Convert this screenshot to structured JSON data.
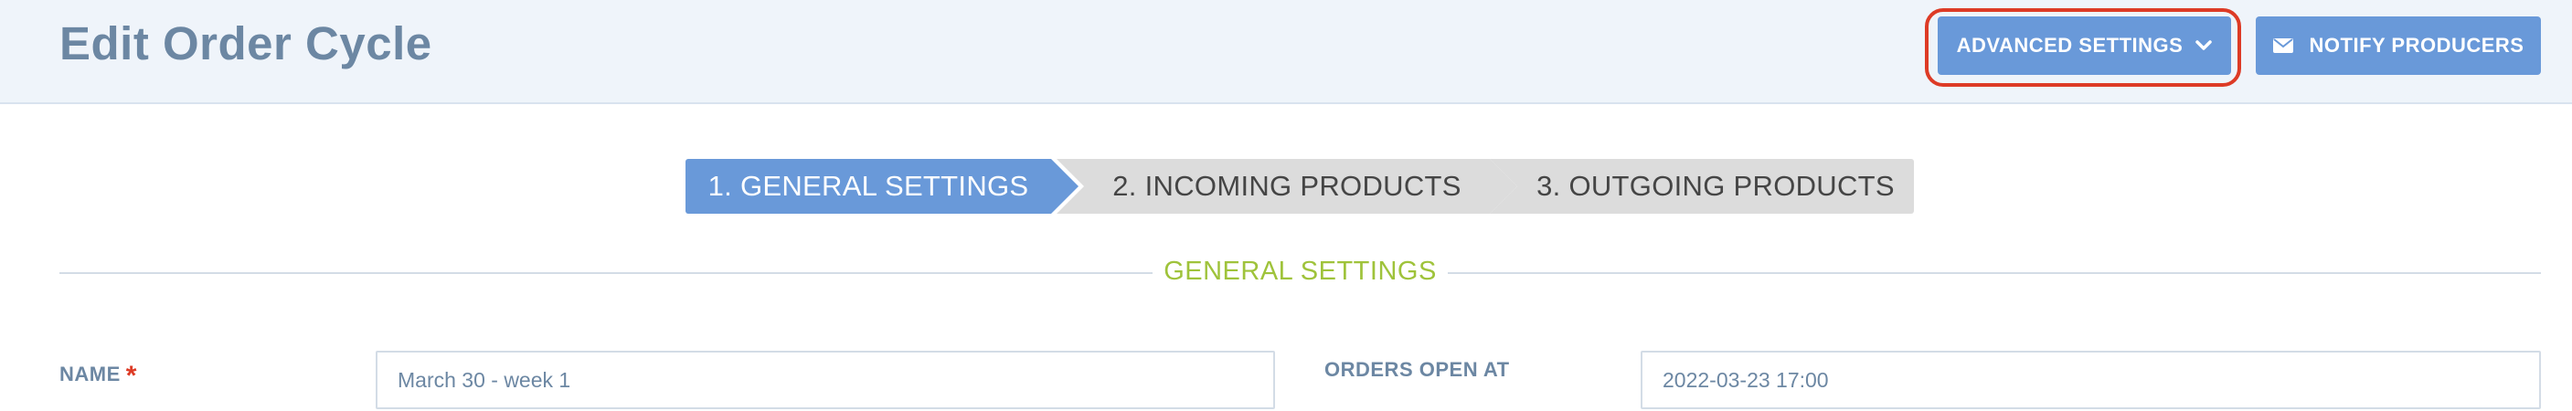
{
  "header": {
    "title": "Edit Order Cycle",
    "advanced_settings_label": "ADVANCED SETTINGS",
    "notify_producers_label": "NOTIFY PRODUCERS",
    "highlight_color": "#dd3b26",
    "accent_color": "#6999d9"
  },
  "steps": [
    {
      "label": "1. GENERAL SETTINGS",
      "active": true
    },
    {
      "label": "2. INCOMING PRODUCTS",
      "active": false
    },
    {
      "label": "3. OUTGOING PRODUCTS",
      "active": false
    }
  ],
  "section": {
    "title": "GENERAL SETTINGS",
    "color": "#9fc33b"
  },
  "form": {
    "name": {
      "label": "NAME",
      "required_marker": "*",
      "value": "March 30 - week 1"
    },
    "orders_open_at": {
      "label": "ORDERS OPEN AT",
      "value": "2022-03-23 17:00"
    }
  },
  "icons": {
    "advanced_settings": "chevron-down-icon",
    "notify_producers": "envelope-icon"
  }
}
